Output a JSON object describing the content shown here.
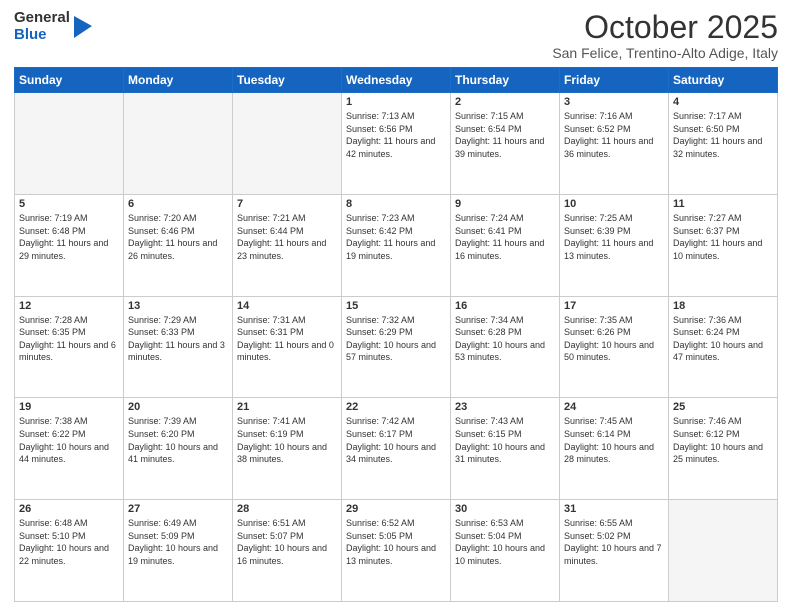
{
  "logo": {
    "general": "General",
    "blue": "Blue"
  },
  "header": {
    "month": "October 2025",
    "location": "San Felice, Trentino-Alto Adige, Italy"
  },
  "days_of_week": [
    "Sunday",
    "Monday",
    "Tuesday",
    "Wednesday",
    "Thursday",
    "Friday",
    "Saturday"
  ],
  "weeks": [
    [
      {
        "day": "",
        "info": ""
      },
      {
        "day": "",
        "info": ""
      },
      {
        "day": "",
        "info": ""
      },
      {
        "day": "1",
        "info": "Sunrise: 7:13 AM\nSunset: 6:56 PM\nDaylight: 11 hours and 42 minutes."
      },
      {
        "day": "2",
        "info": "Sunrise: 7:15 AM\nSunset: 6:54 PM\nDaylight: 11 hours and 39 minutes."
      },
      {
        "day": "3",
        "info": "Sunrise: 7:16 AM\nSunset: 6:52 PM\nDaylight: 11 hours and 36 minutes."
      },
      {
        "day": "4",
        "info": "Sunrise: 7:17 AM\nSunset: 6:50 PM\nDaylight: 11 hours and 32 minutes."
      }
    ],
    [
      {
        "day": "5",
        "info": "Sunrise: 7:19 AM\nSunset: 6:48 PM\nDaylight: 11 hours and 29 minutes."
      },
      {
        "day": "6",
        "info": "Sunrise: 7:20 AM\nSunset: 6:46 PM\nDaylight: 11 hours and 26 minutes."
      },
      {
        "day": "7",
        "info": "Sunrise: 7:21 AM\nSunset: 6:44 PM\nDaylight: 11 hours and 23 minutes."
      },
      {
        "day": "8",
        "info": "Sunrise: 7:23 AM\nSunset: 6:42 PM\nDaylight: 11 hours and 19 minutes."
      },
      {
        "day": "9",
        "info": "Sunrise: 7:24 AM\nSunset: 6:41 PM\nDaylight: 11 hours and 16 minutes."
      },
      {
        "day": "10",
        "info": "Sunrise: 7:25 AM\nSunset: 6:39 PM\nDaylight: 11 hours and 13 minutes."
      },
      {
        "day": "11",
        "info": "Sunrise: 7:27 AM\nSunset: 6:37 PM\nDaylight: 11 hours and 10 minutes."
      }
    ],
    [
      {
        "day": "12",
        "info": "Sunrise: 7:28 AM\nSunset: 6:35 PM\nDaylight: 11 hours and 6 minutes."
      },
      {
        "day": "13",
        "info": "Sunrise: 7:29 AM\nSunset: 6:33 PM\nDaylight: 11 hours and 3 minutes."
      },
      {
        "day": "14",
        "info": "Sunrise: 7:31 AM\nSunset: 6:31 PM\nDaylight: 11 hours and 0 minutes."
      },
      {
        "day": "15",
        "info": "Sunrise: 7:32 AM\nSunset: 6:29 PM\nDaylight: 10 hours and 57 minutes."
      },
      {
        "day": "16",
        "info": "Sunrise: 7:34 AM\nSunset: 6:28 PM\nDaylight: 10 hours and 53 minutes."
      },
      {
        "day": "17",
        "info": "Sunrise: 7:35 AM\nSunset: 6:26 PM\nDaylight: 10 hours and 50 minutes."
      },
      {
        "day": "18",
        "info": "Sunrise: 7:36 AM\nSunset: 6:24 PM\nDaylight: 10 hours and 47 minutes."
      }
    ],
    [
      {
        "day": "19",
        "info": "Sunrise: 7:38 AM\nSunset: 6:22 PM\nDaylight: 10 hours and 44 minutes."
      },
      {
        "day": "20",
        "info": "Sunrise: 7:39 AM\nSunset: 6:20 PM\nDaylight: 10 hours and 41 minutes."
      },
      {
        "day": "21",
        "info": "Sunrise: 7:41 AM\nSunset: 6:19 PM\nDaylight: 10 hours and 38 minutes."
      },
      {
        "day": "22",
        "info": "Sunrise: 7:42 AM\nSunset: 6:17 PM\nDaylight: 10 hours and 34 minutes."
      },
      {
        "day": "23",
        "info": "Sunrise: 7:43 AM\nSunset: 6:15 PM\nDaylight: 10 hours and 31 minutes."
      },
      {
        "day": "24",
        "info": "Sunrise: 7:45 AM\nSunset: 6:14 PM\nDaylight: 10 hours and 28 minutes."
      },
      {
        "day": "25",
        "info": "Sunrise: 7:46 AM\nSunset: 6:12 PM\nDaylight: 10 hours and 25 minutes."
      }
    ],
    [
      {
        "day": "26",
        "info": "Sunrise: 6:48 AM\nSunset: 5:10 PM\nDaylight: 10 hours and 22 minutes."
      },
      {
        "day": "27",
        "info": "Sunrise: 6:49 AM\nSunset: 5:09 PM\nDaylight: 10 hours and 19 minutes."
      },
      {
        "day": "28",
        "info": "Sunrise: 6:51 AM\nSunset: 5:07 PM\nDaylight: 10 hours and 16 minutes."
      },
      {
        "day": "29",
        "info": "Sunrise: 6:52 AM\nSunset: 5:05 PM\nDaylight: 10 hours and 13 minutes."
      },
      {
        "day": "30",
        "info": "Sunrise: 6:53 AM\nSunset: 5:04 PM\nDaylight: 10 hours and 10 minutes."
      },
      {
        "day": "31",
        "info": "Sunrise: 6:55 AM\nSunset: 5:02 PM\nDaylight: 10 hours and 7 minutes."
      },
      {
        "day": "",
        "info": ""
      }
    ]
  ]
}
